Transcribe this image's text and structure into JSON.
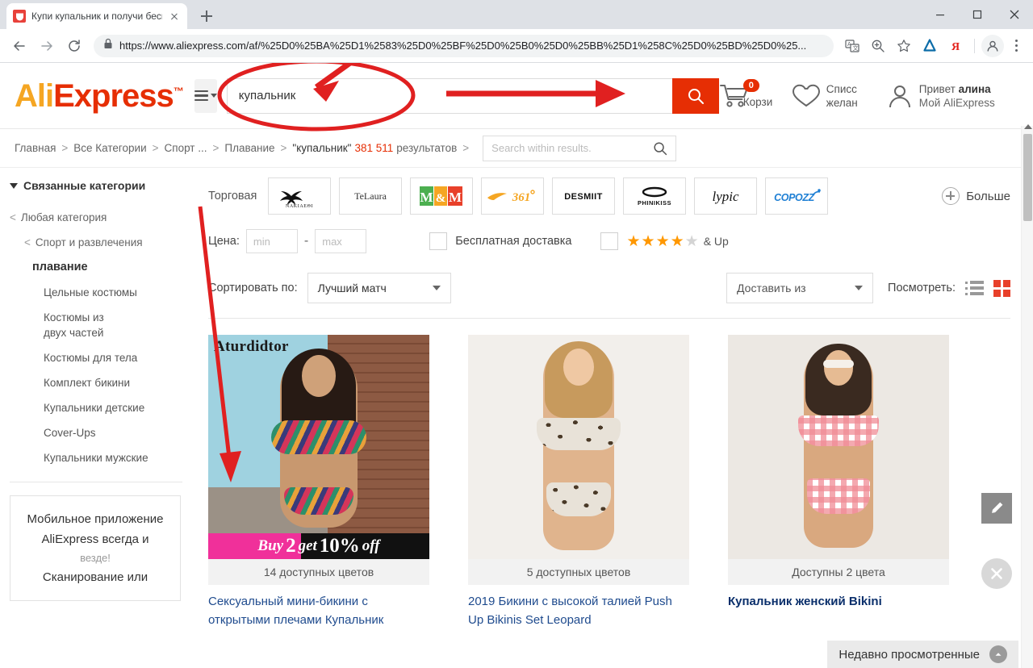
{
  "browser": {
    "tab": {
      "title": "Купи купальник и получи беспл",
      "favicon": "aliexpress-favicon"
    },
    "new_tab_label": "+",
    "url_display": "https://www.aliexpress.com/af/%25D0%25BA%25D1%2583%25D0%25BF%25D0%25B0%25D0%25BB%25D1%258C%25D0%25BD%25D0%25...",
    "url_scheme": "https://",
    "toolbar_icons": [
      "translate-icon",
      "zoom-icon",
      "bookmark-star-icon",
      "drop-extension-icon",
      "yandex-extension-icon",
      "profile-avatar-icon",
      "chrome-menu-icon"
    ],
    "window_controls": [
      "minimize",
      "maximize",
      "close"
    ]
  },
  "header": {
    "logo": {
      "part1": "Ali",
      "part2": "Express",
      "tm": "™"
    },
    "category_button": "all-categories-menu",
    "search": {
      "value": "купальник",
      "placeholder": ""
    },
    "search_button_label": "search-icon",
    "search_button_color": "#e62e04",
    "cart": {
      "label": "Корзи",
      "badge": "0"
    },
    "wishlist": {
      "line1": "Списс",
      "line2": "желан"
    },
    "account": {
      "greeting_prefix": "Привет",
      "user": "алина",
      "line2": "Мой AliExpress"
    }
  },
  "breadcrumb": {
    "items": [
      "Главная",
      "Все Категории",
      "Спорт ...",
      "Плавание"
    ],
    "keyword": "\"купальник\"",
    "count": "381 511",
    "count_suffix": "результатов",
    "separator": ">",
    "search_within": {
      "placeholder": "Search within results.",
      "value": ""
    }
  },
  "sidebar": {
    "title": "Связанные категории",
    "links": [
      {
        "label": "Любая категория",
        "level": "lv0",
        "chevron": "<"
      },
      {
        "label": "Спорт и развлечения",
        "level": "lv1",
        "chevron": "<"
      },
      {
        "label": "плавание",
        "level": "cur",
        "chevron": ""
      },
      {
        "label": "Цельные костюмы",
        "level": "lv2",
        "chevron": ""
      },
      {
        "label": "Костюмы из двух частей",
        "level": "lv2",
        "chevron": ""
      },
      {
        "label": "Костюмы для тела",
        "level": "lv2",
        "chevron": ""
      },
      {
        "label": "Комплект бикини",
        "level": "lv2",
        "chevron": ""
      },
      {
        "label": "Купальники детские",
        "level": "lv2",
        "chevron": ""
      },
      {
        "label": "Cover-Ups",
        "level": "lv2",
        "chevron": ""
      },
      {
        "label": "Купальники мужские",
        "level": "lv2",
        "chevron": ""
      }
    ],
    "promo": {
      "line1": "Мобильное приложение",
      "line2": "AliExpress всегда и",
      "line3": "везде!",
      "line4": "Сканирование или"
    }
  },
  "filters": {
    "brand_label": "Торговая",
    "brands": [
      {
        "name": "NAKIAEΘI",
        "kind": "swan"
      },
      {
        "name": "TeLaura",
        "kind": "text"
      },
      {
        "name": "M&M",
        "kind": "mm"
      },
      {
        "name": "361°",
        "kind": "361"
      },
      {
        "name": "DESMIIT",
        "kind": "bold"
      },
      {
        "name": "PHINIKISS",
        "kind": "phinikiss"
      },
      {
        "name": "lypic",
        "kind": "script"
      },
      {
        "name": "COPOZZ",
        "kind": "copozz"
      }
    ],
    "more_label": "Больше",
    "price_label": "Цена:",
    "price_min_placeholder": "min",
    "price_max_placeholder": "max",
    "price_min_value": "",
    "price_max_value": "",
    "dash": "-",
    "free_shipping_label": "Бесплатная доставка",
    "free_shipping_checked": false,
    "rating_stars_filled": 4,
    "rating_stars_total": 5,
    "rating_suffix": "& Up",
    "rating_checked": false
  },
  "sortbar": {
    "sort_label": "Сортировать по:",
    "sort_value": "Лучший матч",
    "ship_from_value": "Доставить из",
    "view_label": "Посмотреть:",
    "view_list": "list-view-icon",
    "view_grid": "grid-view-icon",
    "active_view": "grid"
  },
  "products": [
    {
      "watermark": "Aturdidtor",
      "banner_pre": "Buy",
      "banner_num": "2",
      "banner_mid": "get",
      "banner_big": "10%",
      "banner_end": "off",
      "colors": "14 доступных цветов",
      "title": "Сексуальный мини-бикини с открытыми плечами Купальник",
      "bold": false
    },
    {
      "colors": "5 доступных цветов",
      "title": "2019 Бикини с высокой талией Push Up Bikinis Set Leopard",
      "bold": false
    },
    {
      "colors": "Доступны 2 цвета",
      "title": "Купальник женский Bikini",
      "bold": true
    }
  ],
  "floating": {
    "edit_icon": "pencil-icon",
    "close_icon": "close-icon"
  },
  "recent": {
    "label": "Недавно просмотренные",
    "chevron": "chevron-up-icon"
  }
}
